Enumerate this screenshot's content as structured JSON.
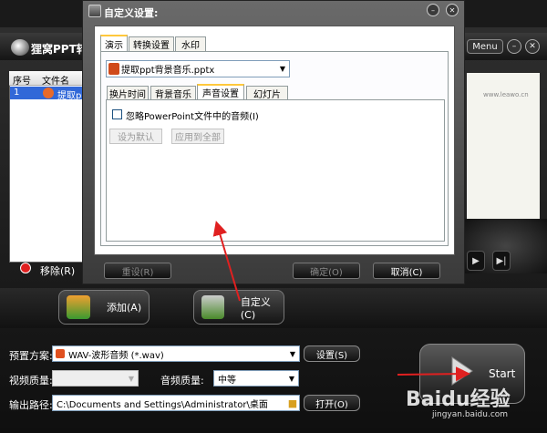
{
  "main_window": {
    "app_title": "狸窝PPT转",
    "menu_label": "Menu",
    "file_list": {
      "headers": [
        "序号",
        "文件名"
      ],
      "rows": [
        {
          "index": "1",
          "name": "提取pp"
        }
      ]
    },
    "remove_label": "移除(R)",
    "preview_text": "www.leawo.cn",
    "toolbar": {
      "add_label": "添加(A)",
      "custom_label": "自定义(C)"
    },
    "settings": {
      "preset_label": "预置方案:",
      "preset_value": "WAV-波形音频 (*.wav)",
      "preset_button": "设置(S)",
      "video_quality_label": "视频质量:",
      "video_quality_value": "",
      "audio_quality_label": "音频质量:",
      "audio_quality_value": "中等",
      "output_label": "输出路径:",
      "output_value": "C:\\Documents and Settings\\Administrator\\桌面",
      "open_button": "打开(O)"
    },
    "start_label": "Start",
    "watermark": "Baidu经验",
    "watermark_url": "jingyan.baidu.com"
  },
  "dialog": {
    "title": "自定义设置:",
    "top_tabs": [
      "演示",
      "转换设置",
      "水印"
    ],
    "file_select_value": "提取ppt背景音乐.pptx",
    "sub_tabs": [
      "换片时间",
      "背景音乐",
      "声音设置",
      "幻灯片"
    ],
    "ignore_audio_label": "忽略PowerPoint文件中的音频(I)",
    "set_default_button": "设为默认",
    "apply_all_button": "应用到全部",
    "reset_button": "重设(R)",
    "ok_button": "确定(O)",
    "cancel_button": "取消(C)"
  },
  "colors": {
    "selection": "#3168d8",
    "tab_accent": "#ffc83c",
    "arrow": "#e02020"
  }
}
